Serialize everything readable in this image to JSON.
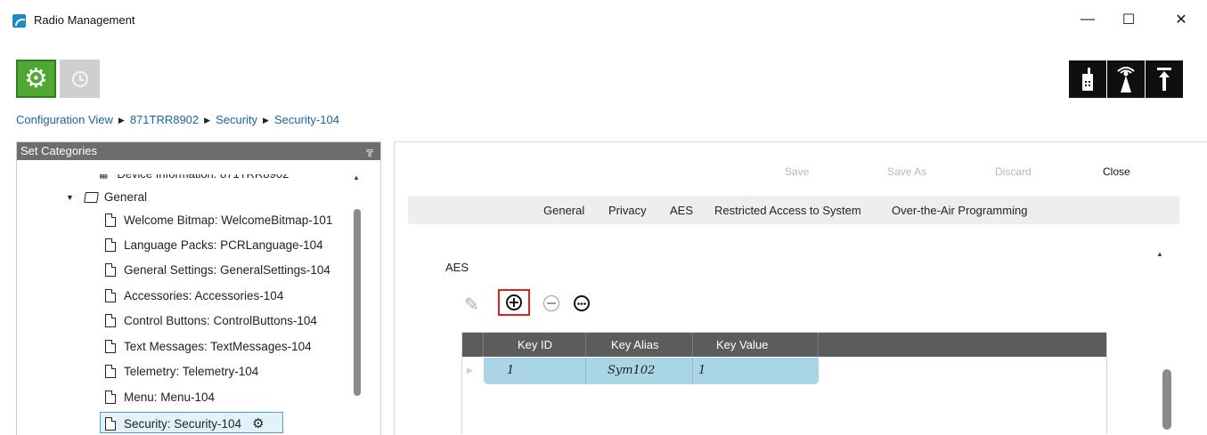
{
  "window": {
    "title": "Radio Management",
    "controls": {
      "minimize": "—",
      "maximize": "☐",
      "close": "✕"
    }
  },
  "toolbar": {
    "left_buttons": [
      {
        "name": "settings",
        "icon": "gear-icon",
        "active": true,
        "color": "#4fa834"
      },
      {
        "name": "history",
        "icon": "clock-icon",
        "active": false,
        "color": "#cfcfcf"
      }
    ],
    "right_buttons": [
      {
        "name": "radio",
        "icon": "handheld-radio-icon"
      },
      {
        "name": "repeater",
        "icon": "tower-icon"
      },
      {
        "name": "upload",
        "icon": "upload-arrow-icon"
      }
    ]
  },
  "breadcrumb": [
    "Configuration View",
    "871TRR8902",
    "Security",
    "Security-104"
  ],
  "left_panel": {
    "header": "Set Categories",
    "items": [
      {
        "label": "Device Information: 871TRR8902",
        "type": "table",
        "partial": true
      },
      {
        "label": "General",
        "type": "folder",
        "expanded": true
      },
      {
        "label": "Welcome Bitmap: WelcomeBitmap-101",
        "type": "doc"
      },
      {
        "label": "Language Packs: PCRLanguage-104",
        "type": "doc"
      },
      {
        "label": "General Settings: GeneralSettings-104",
        "type": "doc"
      },
      {
        "label": "Accessories: Accessories-104",
        "type": "doc"
      },
      {
        "label": "Control Buttons: ControlButtons-104",
        "type": "doc"
      },
      {
        "label": "Text Messages: TextMessages-104",
        "type": "doc"
      },
      {
        "label": "Telemetry: Telemetry-104",
        "type": "doc"
      },
      {
        "label": "Menu: Menu-104",
        "type": "doc"
      },
      {
        "label": "Security: Security-104",
        "type": "doc",
        "selected": true
      }
    ]
  },
  "actions": {
    "save": "Save",
    "save_as": "Save As",
    "discard": "Discard",
    "close": "Close"
  },
  "tabs": [
    "General",
    "Privacy",
    "AES",
    "Restricted Access to System",
    "Over-the-Air Programming"
  ],
  "section": {
    "title": "AES"
  },
  "grid": {
    "columns": [
      "Key ID",
      "Key Alias",
      "Key Value"
    ],
    "rows": [
      {
        "key_id": "1",
        "key_alias": "Sym102",
        "key_value": "1"
      }
    ]
  },
  "colors": {
    "accent_green": "#4fa834",
    "link_blue": "#1a64a8",
    "highlight_red": "#e0201c",
    "row_blue": "#a9d5e5"
  }
}
